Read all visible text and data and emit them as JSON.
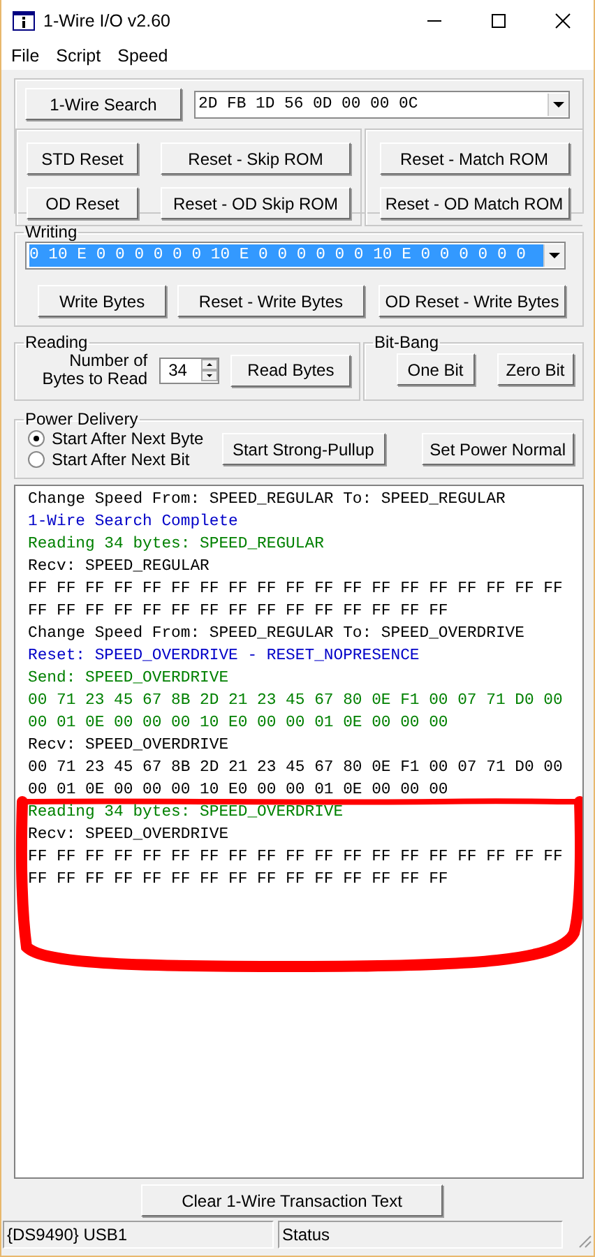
{
  "window": {
    "title": "1-Wire I/O v2.60"
  },
  "menu": [
    "File",
    "Script",
    "Speed"
  ],
  "search_button": "1-Wire Search",
  "rom_select": {
    "value": "2D FB 1D 56 0D 00 00 0C"
  },
  "reset_buttons": [
    "STD Reset",
    "Reset - Skip ROM",
    "OD Reset",
    "Reset - OD Skip ROM"
  ],
  "match_buttons": [
    "Reset - Match ROM",
    "Reset - OD Match ROM"
  ],
  "writing": {
    "title": "Writing",
    "value": "0 10 E 0 0 0 0 0 0 10 E 0 0 0 0 0 0 10 E 0 0 0 0 0 0",
    "buttons": [
      "Write Bytes",
      "Reset - Write Bytes",
      "OD Reset - Write Bytes"
    ]
  },
  "reading": {
    "title": "Reading",
    "label": "Number of Bytes to Read",
    "count": "34",
    "button": "Read Bytes"
  },
  "bit_bang": {
    "title": "Bit-Bang",
    "buttons": [
      "One Bit",
      "Zero Bit"
    ]
  },
  "power": {
    "title": "Power Delivery",
    "options": [
      {
        "label": "Start After Next Byte",
        "selected": true
      },
      {
        "label": "Start After Next Bit",
        "selected": false
      }
    ],
    "buttons": [
      "Start Strong-Pullup",
      "Set Power Normal"
    ]
  },
  "log": [
    {
      "text": "Change Speed From: SPEED_REGULAR To: SPEED_REGULAR",
      "color": "#000000"
    },
    {
      "text": "1-Wire Search Complete",
      "color": "#0000c8"
    },
    {
      "text": "Reading 34 bytes: SPEED_REGULAR",
      "color": "#008000"
    },
    {
      "text": "Recv: SPEED_REGULAR",
      "color": "#000000"
    },
    {
      "text": "FF FF FF FF FF FF FF FF FF FF FF FF FF FF FF FF FF FF FF",
      "color": "#000000"
    },
    {
      "text": "FF FF FF FF FF FF FF FF FF FF FF FF FF FF FF",
      "color": "#000000"
    },
    {
      "text": "Change Speed From: SPEED_REGULAR To: SPEED_OVERDRIVE",
      "color": "#000000"
    },
    {
      "text": "Reset: SPEED_OVERDRIVE - RESET_NOPRESENCE",
      "color": "#0000c8"
    },
    {
      "text": "Send: SPEED_OVERDRIVE",
      "color": "#008000"
    },
    {
      "text": "00 71 23 45 67 8B 2D 21 23 45 67 80 0E F1 00 07 71 D0 00",
      "color": "#008000"
    },
    {
      "text": "00 01 0E 00 00 00 10 E0 00 00 01 0E 00 00 00",
      "color": "#008000"
    },
    {
      "text": "Recv: SPEED_OVERDRIVE",
      "color": "#000000"
    },
    {
      "text": "00 71 23 45 67 8B 2D 21 23 45 67 80 0E F1 00 07 71 D0 00",
      "color": "#000000"
    },
    {
      "text": "00 01 0E 00 00 00 10 E0 00 00 01 0E 00 00 00",
      "color": "#000000"
    },
    {
      "text": "Reading 34 bytes: SPEED_OVERDRIVE",
      "color": "#008000"
    },
    {
      "text": "Recv: SPEED_OVERDRIVE",
      "color": "#000000"
    },
    {
      "text": "FF FF FF FF FF FF FF FF FF FF FF FF FF FF FF FF FF FF FF",
      "color": "#000000"
    },
    {
      "text": "FF FF FF FF FF FF FF FF FF FF FF FF FF FF FF",
      "color": "#000000"
    }
  ],
  "clear_button": "Clear 1-Wire Transaction Text",
  "status_bar": [
    "{DS9490} USB1",
    "Status"
  ]
}
